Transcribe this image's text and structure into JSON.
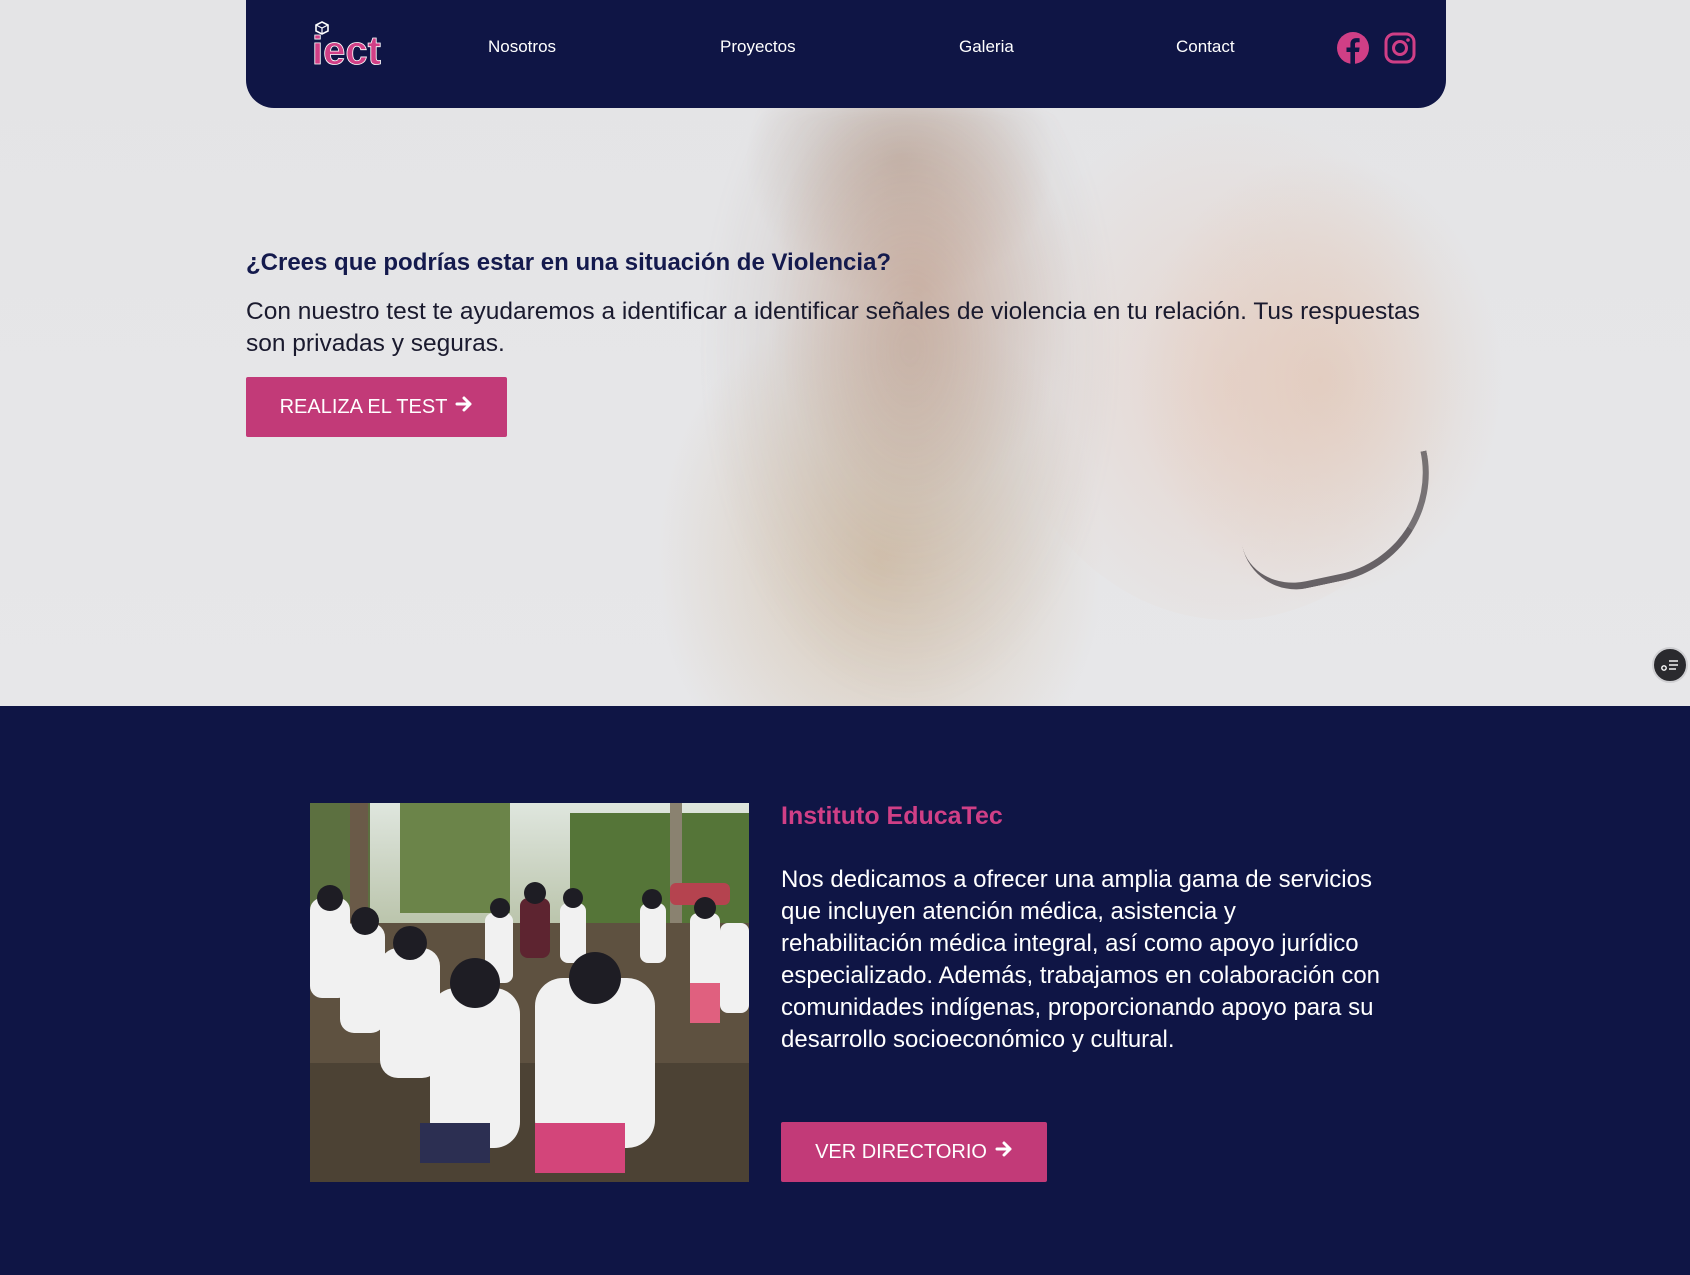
{
  "brand": {
    "logo_text": "iect",
    "primary": "#0f1545",
    "accent": "#c23a78",
    "title_color": "#d03f86"
  },
  "nav": {
    "items": [
      {
        "label": "Nosotros"
      },
      {
        "label": "Proyectos"
      },
      {
        "label": "Galeria"
      },
      {
        "label": "Contact"
      }
    ],
    "social": [
      "facebook-icon",
      "instagram-icon"
    ]
  },
  "hero": {
    "question": "¿Crees que podrías estar en una situación de Violencia?",
    "text": "Con nuestro test te ayudaremos a identificar a identificar señales de violencia en tu relación. Tus respuestas son privadas y seguras.",
    "button_label": "REALIZA EL TEST"
  },
  "about": {
    "title": "Instituto EducaTec",
    "text": "Nos dedicamos a ofrecer una amplia gama de servicios que incluyen atención médica, asistencia y rehabilitación médica integral, así como apoyo jurídico especializado. Además, trabajamos en colaboración con comunidades indígenas, proporcionando apoyo para su desarrollo socioeconómico y cultural.",
    "button_label": "VER DIRECTORIO"
  }
}
